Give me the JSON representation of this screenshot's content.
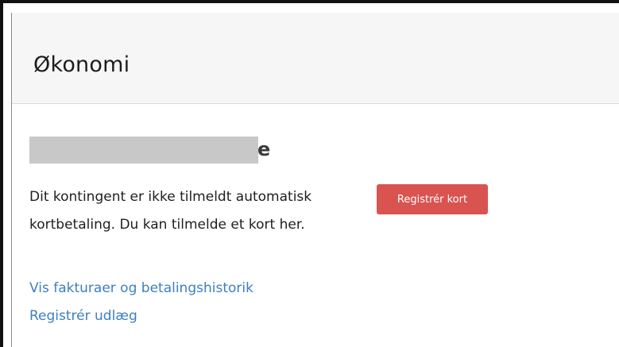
{
  "panel": {
    "title": "Økonomi"
  },
  "membership": {
    "heading_visible_tail": "e",
    "body": "Dit kontingent er ikke tilmeldt automatisk kortbetaling. Du kan tilmelde et kort her.",
    "register_card_label": "Registrér kort"
  },
  "links": {
    "invoices": "Vis fakturaer og betalingshistorik",
    "expense": "Registrér udlæg"
  },
  "colors": {
    "button": "#d9534f",
    "link": "#3d7fc1",
    "header_bg": "#f6f6f6",
    "redaction": "#c8c8c8"
  }
}
